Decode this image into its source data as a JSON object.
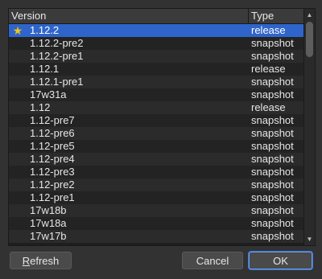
{
  "table": {
    "columns": {
      "version": "Version",
      "type": "Type"
    },
    "rows": [
      {
        "version": "1.12.2",
        "type": "release",
        "starred": true,
        "selected": true
      },
      {
        "version": "1.12.2-pre2",
        "type": "snapshot"
      },
      {
        "version": "1.12.2-pre1",
        "type": "snapshot"
      },
      {
        "version": "1.12.1",
        "type": "release"
      },
      {
        "version": "1.12.1-pre1",
        "type": "snapshot"
      },
      {
        "version": "17w31a",
        "type": "snapshot"
      },
      {
        "version": "1.12",
        "type": "release"
      },
      {
        "version": "1.12-pre7",
        "type": "snapshot"
      },
      {
        "version": "1.12-pre6",
        "type": "snapshot"
      },
      {
        "version": "1.12-pre5",
        "type": "snapshot"
      },
      {
        "version": "1.12-pre4",
        "type": "snapshot"
      },
      {
        "version": "1.12-pre3",
        "type": "snapshot"
      },
      {
        "version": "1.12-pre2",
        "type": "snapshot"
      },
      {
        "version": "1.12-pre1",
        "type": "snapshot"
      },
      {
        "version": "17w18b",
        "type": "snapshot"
      },
      {
        "version": "17w18a",
        "type": "snapshot"
      },
      {
        "version": "17w17b",
        "type": "snapshot"
      }
    ]
  },
  "buttons": {
    "refresh_first": "R",
    "refresh_rest": "efresh",
    "cancel": "Cancel",
    "ok": "OK"
  },
  "icons": {
    "star": "star-icon",
    "scroll_up": "scroll-up-arrow-icon",
    "scroll_down": "scroll-down-arrow-icon"
  },
  "colors": {
    "selection": "#2f65ca",
    "star": "#f0c419",
    "background": "#323232"
  }
}
